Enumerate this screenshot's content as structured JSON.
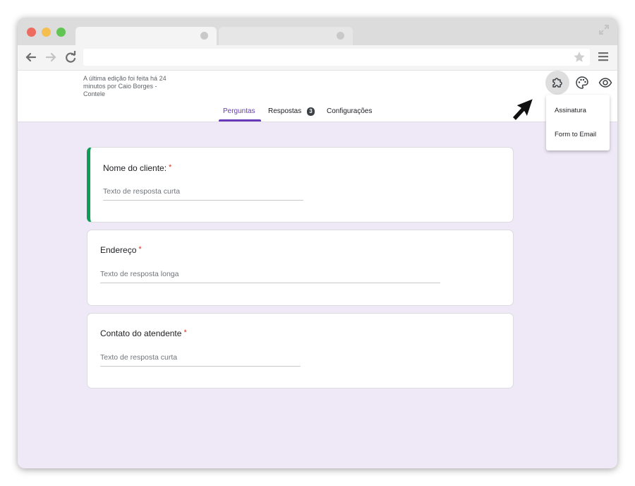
{
  "browser": {
    "tabs": [
      {
        "label": ""
      },
      {
        "label": ""
      }
    ],
    "url": ""
  },
  "header": {
    "last_edit": "A última edição foi feita há 24 minutos por Caio Borges - Contele",
    "tabs": [
      {
        "label": "Perguntas",
        "active": true
      },
      {
        "label": "Respostas",
        "badge": "3",
        "active": false
      },
      {
        "label": "Configurações",
        "active": false
      }
    ],
    "icons": [
      "puzzle-icon",
      "palette-icon",
      "eye-icon"
    ]
  },
  "addons_menu": {
    "items": [
      {
        "label": "Assinatura"
      },
      {
        "label": "Form to Email"
      }
    ]
  },
  "form": {
    "questions": [
      {
        "title": "Nome do cliente:",
        "required": "*",
        "hint": "Texto de resposta curta"
      },
      {
        "title": "Endereço",
        "required": "*",
        "hint": "Texto de resposta longa"
      },
      {
        "title": "Contato do atendente",
        "required": "*",
        "hint": "Texto de resposta curta"
      }
    ]
  },
  "colors": {
    "accent": "#673ab7",
    "selected_border": "#0f9d58",
    "background": "#efe9f7",
    "required": "#d93025"
  }
}
